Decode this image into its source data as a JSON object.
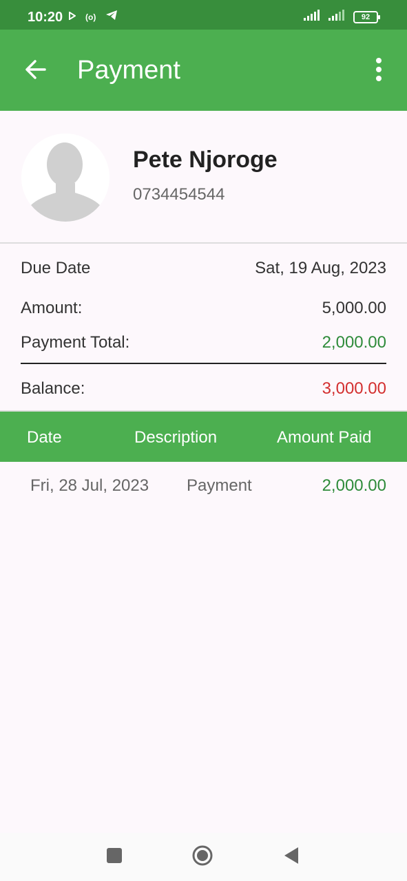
{
  "status_bar": {
    "time": "10:20",
    "battery": "92"
  },
  "app_bar": {
    "title": "Payment"
  },
  "profile": {
    "name": "Pete Njoroge",
    "phone": "0734454544"
  },
  "summary": {
    "due_date_label": "Due Date",
    "due_date_value": "Sat, 19 Aug, 2023",
    "amount_label": "Amount:",
    "amount_value": "5,000.00",
    "payment_total_label": "Payment Total:",
    "payment_total_value": "2,000.00",
    "balance_label": "Balance:",
    "balance_value": "3,000.00"
  },
  "table": {
    "headers": [
      "Date",
      "Description",
      "Amount Paid"
    ],
    "rows": [
      {
        "date": "Fri, 28 Jul, 2023",
        "description": "Payment",
        "amount": "2,000.00"
      }
    ]
  },
  "colors": {
    "primary": "#4caf50",
    "status_bar": "#388e3c",
    "positive": "#2e8b3a",
    "negative": "#d32f2f"
  }
}
